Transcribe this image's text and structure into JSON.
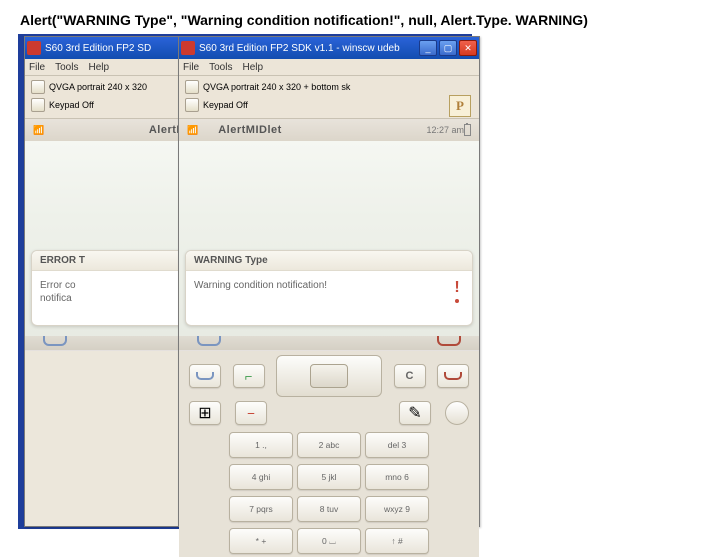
{
  "caption": "Alert(\"WARNING Type\", \"Warning condition notification!\", null, Alert.Type. WARNING)",
  "win": {
    "title_left": "S60 3rd Edition FP2 SD",
    "title_right": "S60 3rd Edition FP2 SDK v1.1 - winscw udeb",
    "menu": {
      "file": "File",
      "tools": "Tools",
      "help": "Help"
    },
    "tb": {
      "res": "QVGA portrait 240 x 320",
      "res_r": "QVGA portrait 240 x 320 + bottom sk",
      "keypad": "Keypad Off"
    }
  },
  "phone": {
    "appname": "AlertMIDlet",
    "time": "12:27 am"
  },
  "alerts": {
    "left": {
      "title": "ERROR T",
      "body": "Error co\nnotifica"
    },
    "right": {
      "title": "WARNING Type",
      "body": "Warning condition notification!"
    }
  },
  "keys": {
    "k1": "1 .,",
    "k2": "2 abc",
    "k3": "del 3",
    "k4": "4 ghi",
    "k5": "5 jkl",
    "k6": "mno 6",
    "k7": "7 pqrs",
    "k8": "8 tuv",
    "k9": "wxyz 9",
    "ks": "* +",
    "k0": "0 ⌴",
    "kh": "↑ #"
  }
}
